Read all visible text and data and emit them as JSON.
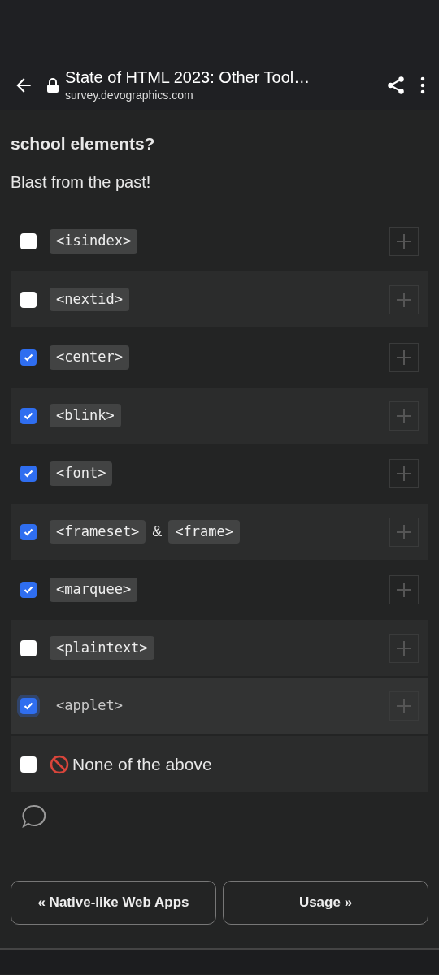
{
  "toolbar": {
    "title": "State of HTML 2023: Other Tool…",
    "url": "survey.devographics.com"
  },
  "question": {
    "title": "school elements?",
    "description": "Blast from the past!"
  },
  "options": [
    {
      "kind": "element",
      "checked": false,
      "focused": false,
      "label": [
        {
          "kind": "code",
          "text": "<isindex>"
        }
      ]
    },
    {
      "kind": "element",
      "checked": false,
      "focused": false,
      "label": [
        {
          "kind": "code",
          "text": "<nextid>"
        }
      ]
    },
    {
      "kind": "element",
      "checked": true,
      "focused": false,
      "label": [
        {
          "kind": "code",
          "text": "<center>"
        }
      ]
    },
    {
      "kind": "element",
      "checked": true,
      "focused": false,
      "label": [
        {
          "kind": "code",
          "text": "<blink>"
        }
      ]
    },
    {
      "kind": "element",
      "checked": true,
      "focused": false,
      "label": [
        {
          "kind": "code",
          "text": "<font>"
        }
      ]
    },
    {
      "kind": "element",
      "checked": true,
      "focused": false,
      "label": [
        {
          "kind": "code",
          "text": "<frameset>"
        },
        {
          "kind": "text",
          "text": "&"
        },
        {
          "kind": "code",
          "text": "<frame>"
        }
      ]
    },
    {
      "kind": "element",
      "checked": true,
      "focused": false,
      "label": [
        {
          "kind": "code",
          "text": "<marquee>"
        }
      ]
    },
    {
      "kind": "element",
      "checked": false,
      "focused": false,
      "label": [
        {
          "kind": "code",
          "text": "<plaintext>"
        }
      ]
    },
    {
      "kind": "element",
      "checked": true,
      "focused": true,
      "label": [
        {
          "kind": "code",
          "text": "<applet>"
        }
      ]
    },
    {
      "kind": "none",
      "checked": false,
      "focused": false,
      "label": [
        {
          "kind": "text",
          "text": "None of the above"
        }
      ]
    }
  ],
  "nav": {
    "previous": "« Native-like Web Apps",
    "next": "Usage »"
  }
}
